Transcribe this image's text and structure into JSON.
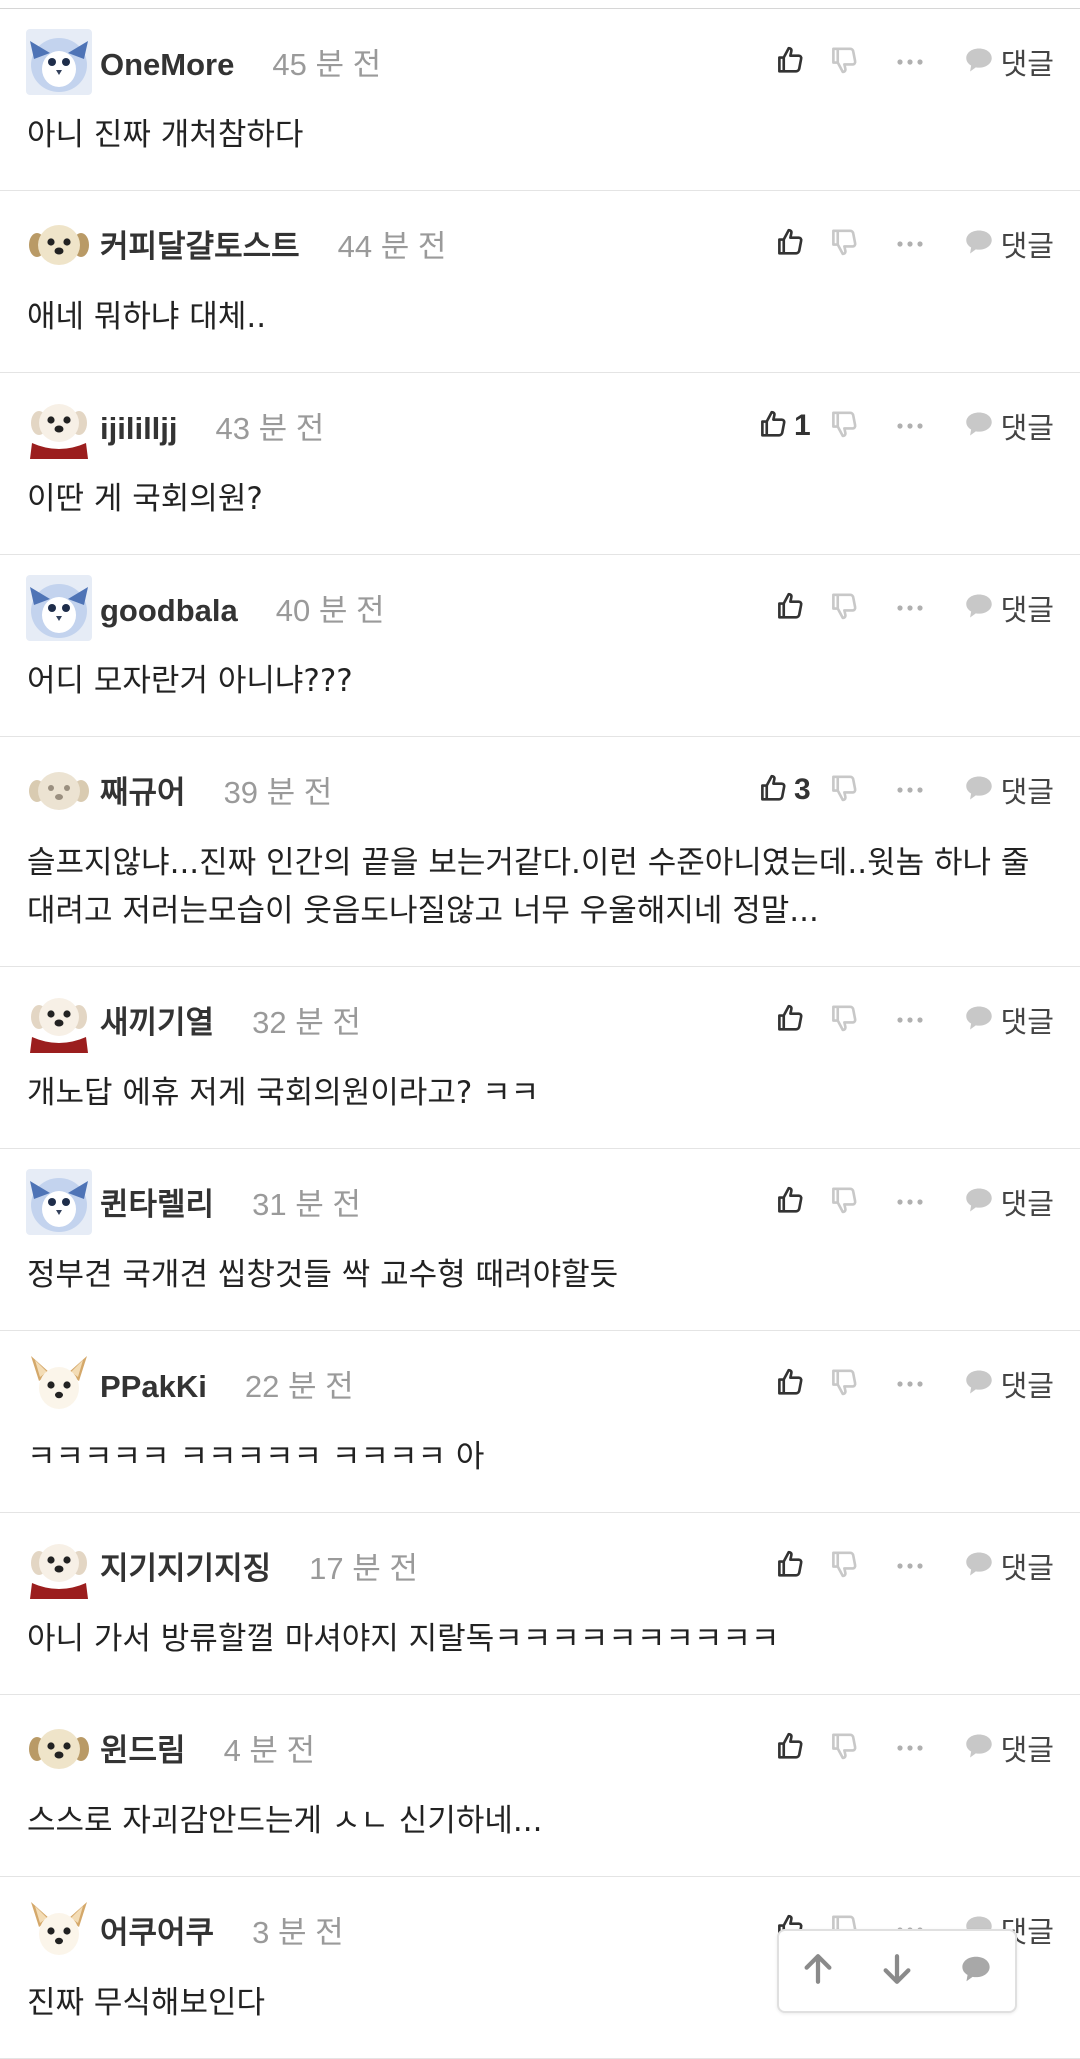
{
  "comments": [
    {
      "username": "OneMore",
      "time": "45 분 전",
      "text": "아니 진짜 개처참하다",
      "likes": "",
      "avatar": "blue-owl"
    },
    {
      "username": "커피달걀토스트",
      "time": "44 분 전",
      "text": "애네 뭐하냐 대체..",
      "likes": "",
      "avatar": "beige-dog"
    },
    {
      "username": "ijililljj",
      "time": "43 분 전",
      "text": "이딴 게 국회의원?",
      "likes": "1",
      "avatar": "red-scarf-dog"
    },
    {
      "username": "goodbala",
      "time": "40 분 전",
      "text": "어디 모자란거 아니냐???",
      "likes": "",
      "avatar": "blue-owl"
    },
    {
      "username": "째규어",
      "time": "39 분 전",
      "text": "슬프지않냐...진짜 인간의 끝을 보는거같다.이런 수준아니였는데..윗놈 하나 줄대려고 저러는모습이 웃음도나질않고 너무 우울해지네 정말...",
      "likes": "3",
      "avatar": "pale-dog"
    },
    {
      "username": "새끼기열",
      "time": "32 분 전",
      "text": "개노답 에휴 저게 국회의원이라고? ㅋㅋ",
      "likes": "",
      "avatar": "red-scarf-dog"
    },
    {
      "username": "퀸타렐리",
      "time": "31 분 전",
      "text": "정부견 국개견 씹창것들 싹 교수형 때려야할듯",
      "likes": "",
      "avatar": "blue-owl"
    },
    {
      "username": "PPakKi",
      "time": "22 분 전",
      "text": "ㅋㅋㅋㅋㅋ ㅋㅋㅋㅋㅋ ㅋㅋㅋㅋ 아",
      "likes": "",
      "avatar": "chihuahua"
    },
    {
      "username": "지기지기지징",
      "time": "17 분 전",
      "text": "아니 가서 방류할껄 마셔야지 지랄독ㅋㅋㅋㅋㅋㅋㅋㅋㅋㅋ",
      "likes": "",
      "avatar": "red-scarf-dog"
    },
    {
      "username": "윈드림",
      "time": "4 분 전",
      "text": "스스로 자괴감안드는게 ㅅㄴ 신기하네...",
      "likes": "",
      "avatar": "beige-dog"
    },
    {
      "username": "어쿠어쿠",
      "time": "3 분 전",
      "text": "진짜 무식해보인다",
      "likes": "",
      "avatar": "chihuahua"
    }
  ],
  "labels": {
    "reply": "댓글"
  },
  "icons": {
    "like": "thumbs-up-icon",
    "dislike": "thumbs-down-icon",
    "more": "more-dots-icon",
    "reply": "speech-bubble-icon",
    "scroll_up": "arrow-up-icon",
    "scroll_down": "arrow-down-icon",
    "comment": "speech-bubble-icon"
  },
  "colors": {
    "text": "#222222",
    "meta": "#9a9a9a",
    "icon": "#333333",
    "icon_muted": "#c8c8c8",
    "divider": "#e4e4e4"
  }
}
